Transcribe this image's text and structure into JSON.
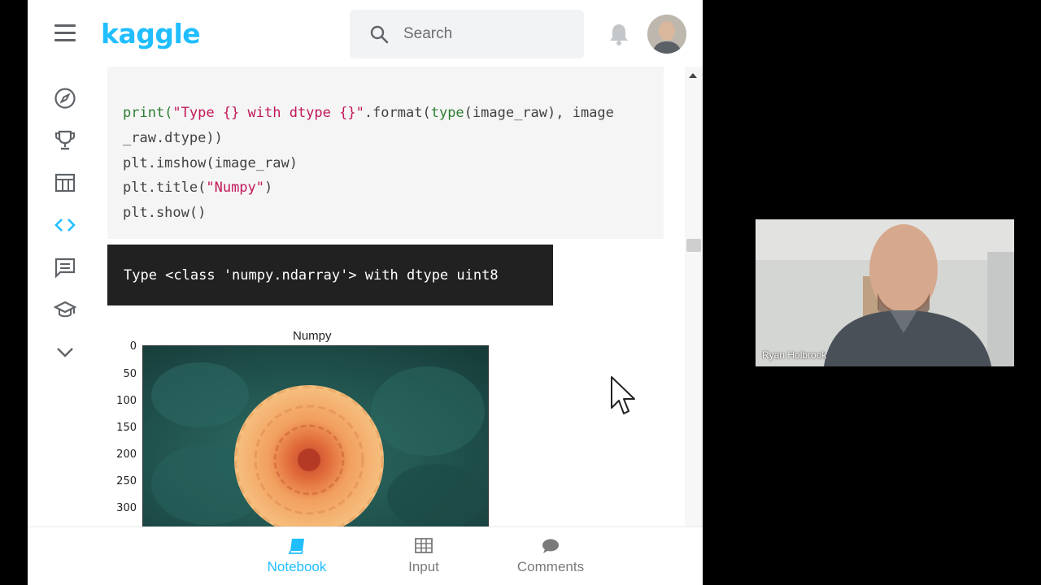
{
  "app": {
    "logo": "kaggle",
    "search": {
      "placeholder": "Search"
    }
  },
  "nav": {
    "items": [
      "compass-icon",
      "trophy-icon",
      "table-icon",
      "code-icon",
      "comments-icon",
      "school-icon",
      "chevron-down-icon"
    ],
    "active": "code-icon"
  },
  "notebook": {
    "code_cell": {
      "line1_fn": "print(",
      "line1_str": "\"Type {} with dtype {}\"",
      "line1_mid": ".format(",
      "line1_kw": "type",
      "line1_end": "(image_raw), image",
      "line2": "_raw.dtype))",
      "line3": "plt.imshow(image_raw)",
      "line4_start": "plt.title(",
      "line4_str": "\"Numpy\"",
      "line4_end": ")",
      "line5": "plt.show()"
    },
    "output_text": "Type <class 'numpy.ndarray'> with dtype uint8",
    "plot": {
      "title": "Numpy",
      "yticks": [
        "0",
        "50",
        "100",
        "150",
        "200",
        "250",
        "300"
      ]
    }
  },
  "bottom_tabs": [
    {
      "label": "Notebook",
      "icon": "book-icon",
      "active": true
    },
    {
      "label": "Input",
      "icon": "grid-icon",
      "active": false
    },
    {
      "label": "Comments",
      "icon": "chat-bubble-icon",
      "active": false
    }
  ],
  "webcam": {
    "name": "Ryan Holbrook"
  },
  "colors": {
    "accent": "#20beff",
    "code_bg": "#f5f5f5",
    "output_bg": "#212121",
    "keyword": "#2e7d32",
    "string": "#c2185b"
  }
}
